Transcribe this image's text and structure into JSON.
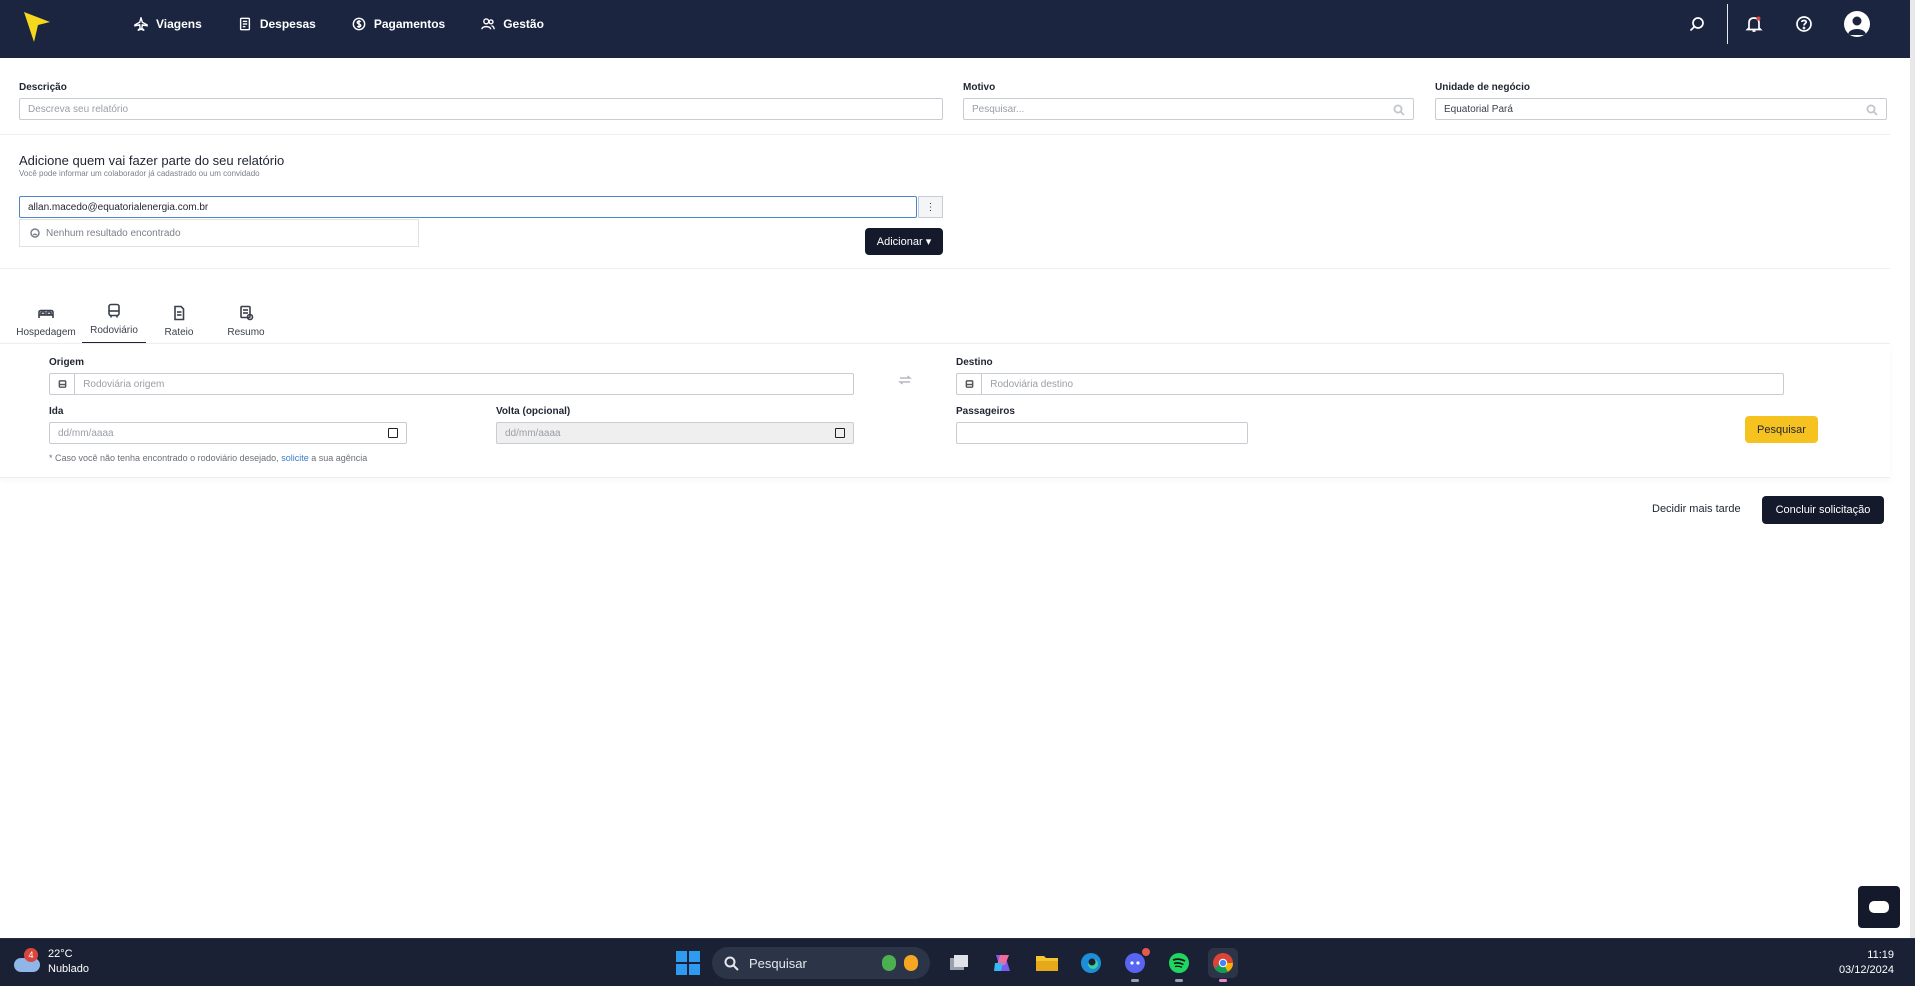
{
  "nav": {
    "items": [
      {
        "label": "Viagens",
        "icon": "plane-icon"
      },
      {
        "label": "Despesas",
        "icon": "receipt-icon"
      },
      {
        "label": "Pagamentos",
        "icon": "dollar-icon"
      },
      {
        "label": "Gestão",
        "icon": "users-icon"
      }
    ]
  },
  "form": {
    "descricao": {
      "label": "Descrição",
      "placeholder": "Descreva seu relatório"
    },
    "motivo": {
      "label": "Motivo",
      "placeholder": "Pesquisar..."
    },
    "unidade": {
      "label": "Unidade de negócio",
      "value": "Equatorial Pará"
    }
  },
  "participants": {
    "title": "Adicione quem vai fazer parte do seu relatório",
    "subtitle": "Você pode informar um colaborador já cadastrado ou um convidado",
    "email_value": "allan.macedo@equatorialenergia.com.br",
    "kebab": "⋮",
    "no_results": "Nenhum resultado encontrado",
    "add_button": "Adicionar ▾"
  },
  "tabs": [
    {
      "label": "Hospedagem",
      "icon": "bed-icon"
    },
    {
      "label": "Rodoviário",
      "icon": "bus-icon"
    },
    {
      "label": "Rateio",
      "icon": "document-icon"
    },
    {
      "label": "Resumo",
      "icon": "summary-icon"
    }
  ],
  "bus": {
    "origem_label": "Origem",
    "origem_placeholder": "Rodoviária origem",
    "destino_label": "Destino",
    "destino_placeholder": "Rodoviária destino",
    "ida_label": "Ida",
    "ida_placeholder": "dd/mm/aaaa",
    "volta_label": "Volta (opcional)",
    "volta_placeholder": "dd/mm/aaaa",
    "passageiros_label": "Passageiros",
    "search_button": "Pesquisar",
    "footnote_before": "* Caso você não tenha encontrado o rodoviário desejado,",
    "footnote_link": "solicite",
    "footnote_after": "a sua agência"
  },
  "actions": {
    "later": "Decidir mais tarde",
    "finish": "Concluir solicitação"
  },
  "taskbar": {
    "weather_badge": "4",
    "temperature": "22°C",
    "condition": "Nublado",
    "search": "Pesquisar",
    "time": "11:19",
    "date": "03/12/2024"
  },
  "colors": {
    "topbar": "#1b2540",
    "accent_yellow": "#f5c220",
    "dark_button": "#141a2c",
    "link_blue": "#3a7bc8"
  }
}
